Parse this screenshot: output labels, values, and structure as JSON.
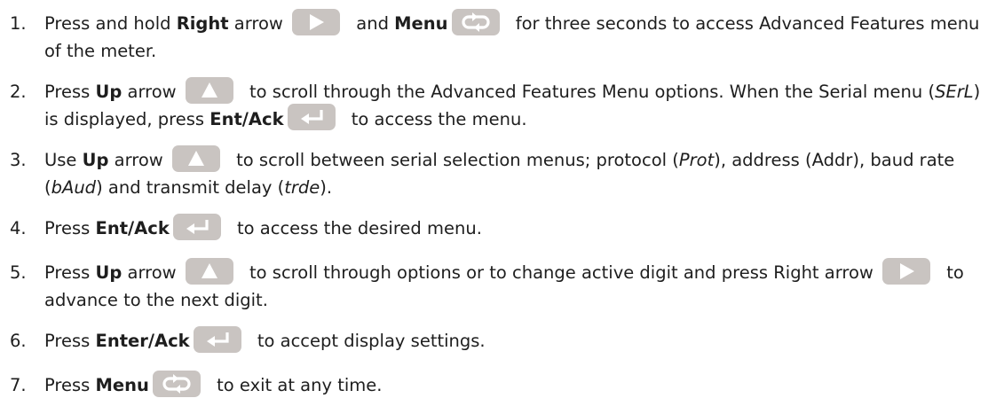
{
  "icon_color": "#c9c4c1",
  "glyph_color": "#ffffff",
  "icons": {
    "right": "right-arrow-key-icon",
    "menu": "menu-key-icon",
    "up": "up-arrow-key-icon",
    "enter": "enter-key-icon"
  },
  "steps": [
    {
      "num": "1.",
      "t1": "Press and hold ",
      "b1": "Right",
      "t2": " arrow ",
      "t3": " and ",
      "b2": "Menu",
      "t4": " for three seconds to access Advanced Features menu of the meter."
    },
    {
      "num": "2.",
      "t1": "Press ",
      "b1": "Up",
      "t2": " arrow ",
      "t3": " to scroll through the Advanced Features Menu options. When the Serial menu (",
      "i1": "SErL",
      "t4": ") is displayed, press ",
      "b2": "Ent/Ack",
      "t5": " to access the menu."
    },
    {
      "num": "3.",
      "t1": "Use ",
      "b1": "Up",
      "t2": " arrow ",
      "t3": " to scroll between serial selection menus; protocol (",
      "i1": "Prot",
      "t4": "), address (Addr), baud rate (",
      "i2": "bAud",
      "t5": ") and transmit delay (",
      "i3": "trde",
      "t6": ")."
    },
    {
      "num": "4.",
      "t1": "Press ",
      "b1": "Ent/Ack",
      "t2": " to access the desired menu."
    },
    {
      "num": "5.",
      "t1": "Press ",
      "b1": "Up",
      "t2": " arrow ",
      "t3": " to scroll through options or to change active digit and press Right arrow ",
      "t4": " to advance to the next digit."
    },
    {
      "num": "6.",
      "t1": "Press ",
      "b1": "Enter/Ack",
      "t2": " to accept display settings."
    },
    {
      "num": "7.",
      "t1": "Press ",
      "b1": "Menu",
      "t2": " to exit at any time."
    }
  ]
}
